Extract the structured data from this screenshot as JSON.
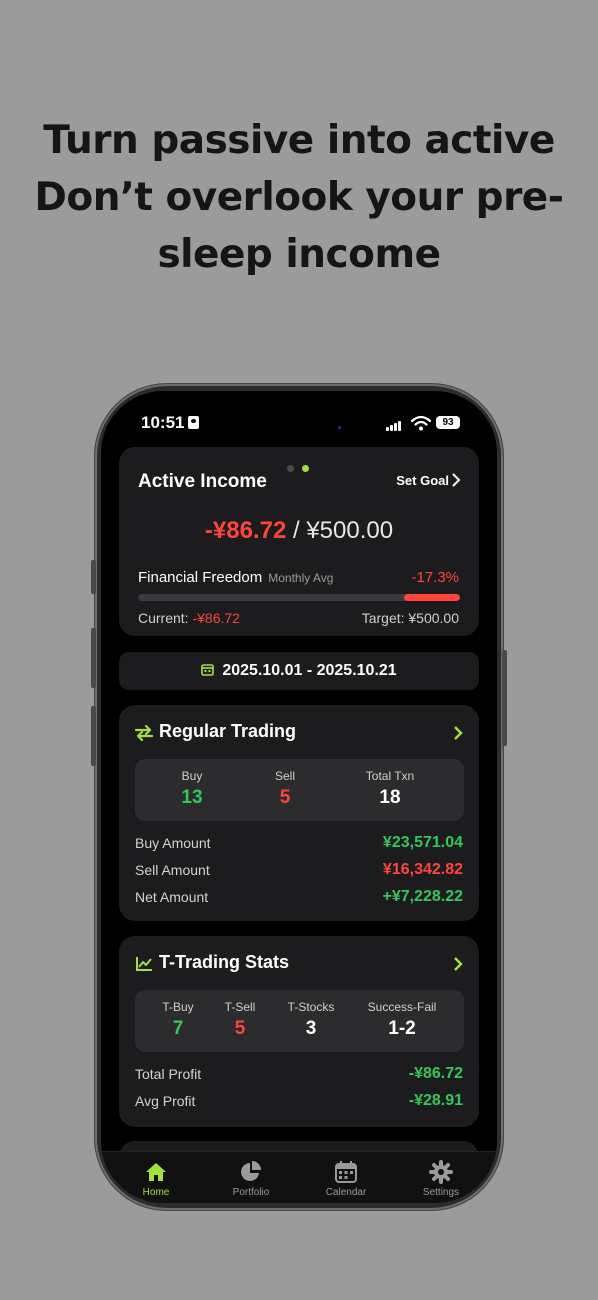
{
  "headline": {
    "line1": "Turn passive into active",
    "line2": "Don’t overlook your pre-",
    "line3": "sleep income"
  },
  "status_bar": {
    "time": "10:51",
    "battery": "93"
  },
  "income_card": {
    "title": "Active Income",
    "set_goal": "Set Goal",
    "current_value": "-¥86.72",
    "separator": "/",
    "target_value": "¥500.00",
    "financial_freedom_label": "Financial Freedom",
    "monthly_avg_label": "Monthly Avg",
    "percent": "-17.3%",
    "progress_fraction": 0.173,
    "current_label": "Current:",
    "current_amount": "-¥86.72",
    "target_label": "Target: ¥500.00"
  },
  "date_range": "2025.10.01 - 2025.10.21",
  "regular_trading": {
    "title": "Regular Trading",
    "stats": [
      {
        "label": "Buy",
        "value": "13"
      },
      {
        "label": "Sell",
        "value": "5"
      },
      {
        "label": "Total Txn",
        "value": "18"
      }
    ],
    "rows": [
      {
        "label": "Buy Amount",
        "value": "¥23,571.04"
      },
      {
        "label": "Sell Amount",
        "value": "¥16,342.82"
      },
      {
        "label": "Net Amount",
        "value": "+¥7,228.22"
      }
    ]
  },
  "t_trading": {
    "title": "T-Trading Stats",
    "stats": [
      {
        "label": "T-Buy",
        "value": "7"
      },
      {
        "label": "T-Sell",
        "value": "5"
      },
      {
        "label": "T-Stocks",
        "value": "3"
      },
      {
        "label": "Success-Fail",
        "value": "1-2"
      }
    ],
    "rows": [
      {
        "label": "Total Profit",
        "value": "-¥86.72"
      },
      {
        "label": "Avg Profit",
        "value": "-¥28.91"
      }
    ]
  },
  "tabs": [
    {
      "label": "Home"
    },
    {
      "label": "Portfolio"
    },
    {
      "label": "Calendar"
    },
    {
      "label": "Settings"
    }
  ],
  "colors": {
    "accent": "#a4e23a",
    "negative": "#ff453a",
    "positive": "#34c759",
    "card": "#1c1c1e",
    "background": "#9b9b9b"
  }
}
